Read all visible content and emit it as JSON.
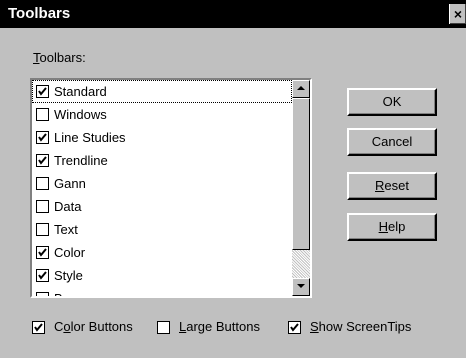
{
  "window": {
    "title": "Toolbars",
    "close_label": "×"
  },
  "section": {
    "label_underlined": "T",
    "label_rest": "oolbars:"
  },
  "toolbars": [
    {
      "label": "Standard",
      "checked": true
    },
    {
      "label": "Windows",
      "checked": false
    },
    {
      "label": "Line Studies",
      "checked": true
    },
    {
      "label": "Trendline",
      "checked": true
    },
    {
      "label": "Gann",
      "checked": false
    },
    {
      "label": "Data",
      "checked": false
    },
    {
      "label": "Text",
      "checked": false
    },
    {
      "label": "Color",
      "checked": true
    },
    {
      "label": "Style",
      "checked": true
    },
    {
      "label": "Bar...",
      "checked": false
    }
  ],
  "buttons": {
    "ok": "OK",
    "cancel": "Cancel",
    "reset": {
      "underlined": "R",
      "rest": "eset"
    },
    "help": {
      "underlined": "H",
      "rest": "elp"
    }
  },
  "options": {
    "color_buttons": {
      "pre": "C",
      "underlined": "o",
      "post": "lor Buttons",
      "checked": true
    },
    "large_buttons": {
      "pre": "",
      "underlined": "L",
      "post": "arge Buttons",
      "checked": false
    },
    "show_screentips": {
      "pre": "",
      "underlined": "S",
      "post": "how ScreenTips",
      "checked": true
    }
  }
}
